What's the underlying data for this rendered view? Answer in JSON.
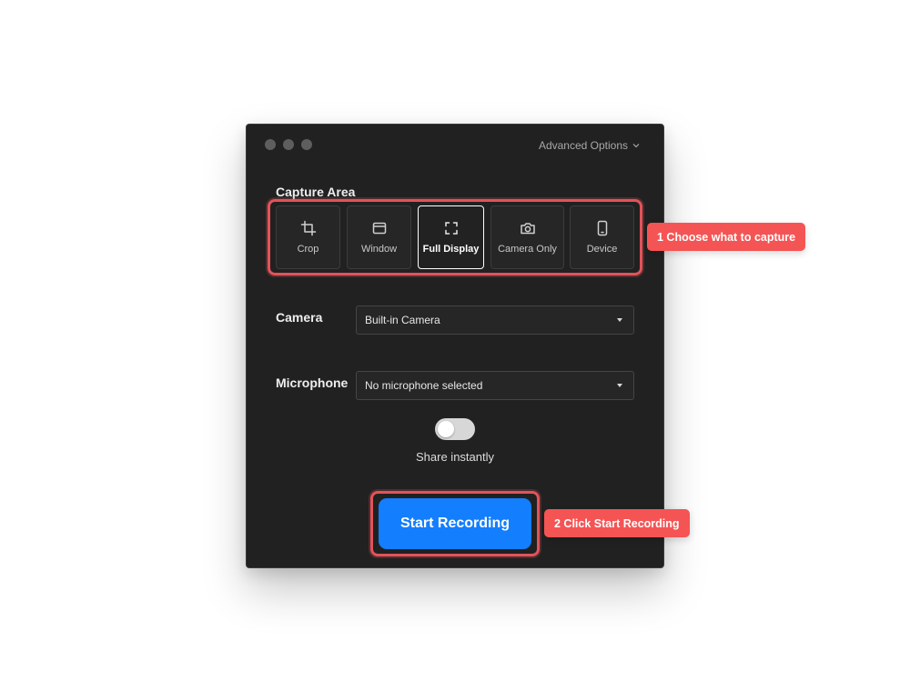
{
  "header": {
    "advanced_options": "Advanced Options"
  },
  "capture_area": {
    "title": "Capture Area",
    "options": [
      {
        "label": "Crop",
        "icon": "crop-icon"
      },
      {
        "label": "Window",
        "icon": "window-icon"
      },
      {
        "label": "Full Display",
        "icon": "full-display-icon",
        "selected": true
      },
      {
        "label": "Camera Only",
        "icon": "camera-icon"
      },
      {
        "label": "Device",
        "icon": "device-icon"
      }
    ]
  },
  "camera": {
    "label": "Camera",
    "value": "Built-in Camera"
  },
  "microphone": {
    "label": "Microphone",
    "value": "No microphone selected"
  },
  "share": {
    "label": "Share instantly",
    "enabled": false
  },
  "start_button": {
    "label": "Start Recording"
  },
  "callouts": {
    "step1": "1 Choose what to capture",
    "step2": "2 Click Start Recording"
  },
  "colors": {
    "window_bg": "#212121",
    "accent_blue": "#137efe",
    "highlight_red": "#e2535a",
    "callout_red": "#f55454"
  }
}
